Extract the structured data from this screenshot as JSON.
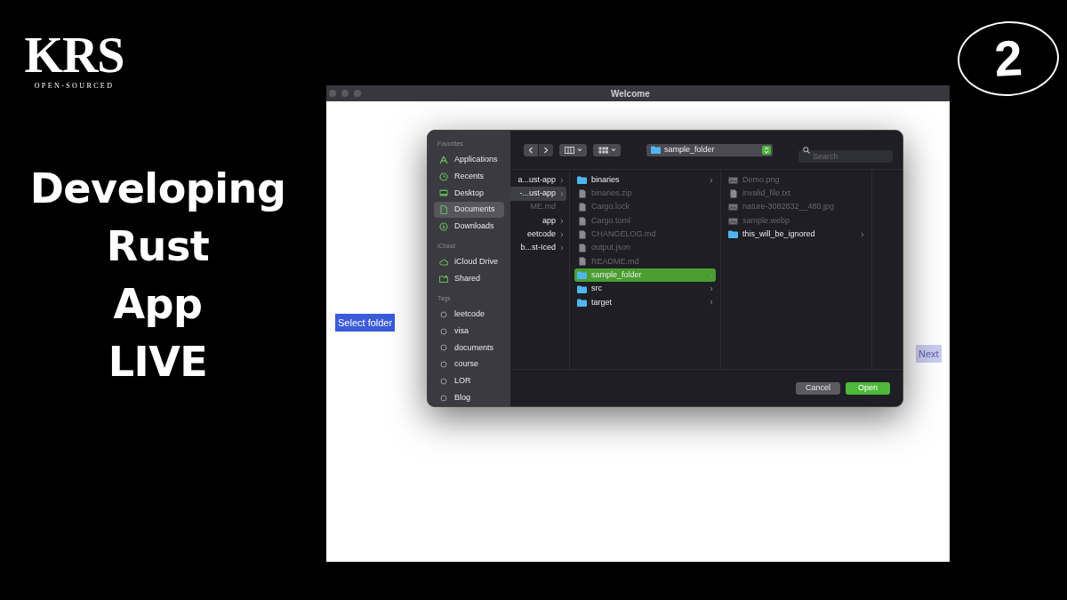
{
  "branding": {
    "logo": "KRS",
    "tagline": "OPEN-SOURCED",
    "headline": [
      "Developing",
      "Rust",
      "App",
      "LIVE"
    ],
    "episode": "2"
  },
  "window": {
    "title": "Welcome",
    "buttons": [
      {
        "label": "Select folder",
        "disabled": false
      },
      {
        "label": "Next",
        "disabled": true
      }
    ]
  },
  "dialog": {
    "toolbar": {
      "path": "sample_folder",
      "search_placeholder": "Search"
    },
    "sidebar": [
      {
        "heading": "Favorites",
        "items": [
          {
            "label": "Applications",
            "kind": "apps",
            "selected": false
          },
          {
            "label": "Recents",
            "kind": "clock",
            "selected": false
          },
          {
            "label": "Desktop",
            "kind": "desktop",
            "selected": false
          },
          {
            "label": "Documents",
            "kind": "document",
            "selected": true
          },
          {
            "label": "Downloads",
            "kind": "download",
            "selected": false
          }
        ]
      },
      {
        "heading": "iCloud",
        "items": [
          {
            "label": "iCloud Drive",
            "kind": "cloud",
            "selected": false
          },
          {
            "label": "Shared",
            "kind": "shared",
            "selected": false
          }
        ]
      },
      {
        "heading": "Tags",
        "items": [
          {
            "label": "leetcode",
            "kind": "tag",
            "selected": false
          },
          {
            "label": "visa",
            "kind": "tag",
            "selected": false
          },
          {
            "label": "documents",
            "kind": "tag",
            "selected": false
          },
          {
            "label": "course",
            "kind": "tag",
            "selected": false
          },
          {
            "label": "LOR",
            "kind": "tag",
            "selected": false
          },
          {
            "label": "Blog",
            "kind": "tag",
            "selected": false
          }
        ]
      }
    ],
    "columns": [
      {
        "items": [
          {
            "label": "a...ust-app",
            "kind": "folder",
            "selected": false,
            "disabled": false
          },
          {
            "label": "-...ust-app",
            "kind": "folder",
            "selected": true,
            "disabled": false
          },
          {
            "label": "ME.md",
            "kind": "file",
            "selected": false,
            "disabled": true
          },
          {
            "label": "app",
            "kind": "folder",
            "selected": false,
            "disabled": false
          },
          {
            "label": "eetcode",
            "kind": "folder",
            "selected": false,
            "disabled": false
          },
          {
            "label": "b...st-Iced",
            "kind": "folder",
            "selected": false,
            "disabled": false
          }
        ]
      },
      {
        "items": [
          {
            "label": "binaries",
            "kind": "folder",
            "selected": false,
            "disabled": false
          },
          {
            "label": "binaries.zip",
            "kind": "file",
            "selected": false,
            "disabled": true
          },
          {
            "label": "Cargo.lock",
            "kind": "file",
            "selected": false,
            "disabled": true
          },
          {
            "label": "Cargo.toml",
            "kind": "file",
            "selected": false,
            "disabled": true
          },
          {
            "label": "CHANGELOG.md",
            "kind": "file",
            "selected": false,
            "disabled": true
          },
          {
            "label": "output.json",
            "kind": "file",
            "selected": false,
            "disabled": true
          },
          {
            "label": "README.md",
            "kind": "file",
            "selected": false,
            "disabled": true
          },
          {
            "label": "sample_folder",
            "kind": "folder",
            "selected": true,
            "disabled": false
          },
          {
            "label": "src",
            "kind": "folder",
            "selected": false,
            "disabled": false
          },
          {
            "label": "target",
            "kind": "folder",
            "selected": false,
            "disabled": false
          }
        ]
      },
      {
        "items": [
          {
            "label": "Demo.png",
            "kind": "image",
            "selected": false,
            "disabled": true
          },
          {
            "label": "invalid_file.txt",
            "kind": "file",
            "selected": false,
            "disabled": true
          },
          {
            "label": "nature-3082832__480.jpg",
            "kind": "image",
            "selected": false,
            "disabled": true
          },
          {
            "label": "sample.webp",
            "kind": "image",
            "selected": false,
            "disabled": true
          },
          {
            "label": "this_will_be_ignored",
            "kind": "folder",
            "selected": false,
            "disabled": false
          }
        ]
      }
    ],
    "buttons": [
      {
        "label": "Cancel",
        "kind": "secondary"
      },
      {
        "label": "Open",
        "kind": "primary"
      }
    ]
  }
}
